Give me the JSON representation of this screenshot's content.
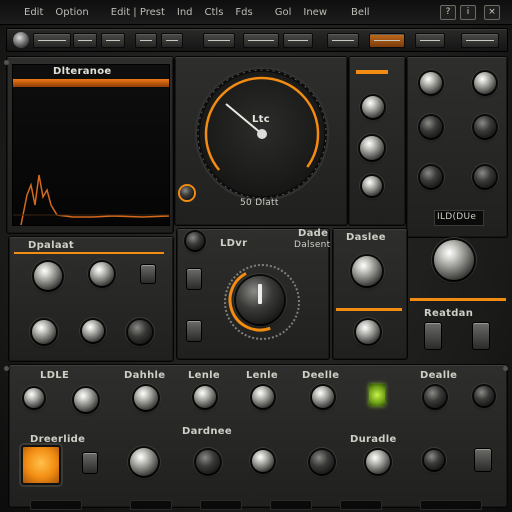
{
  "menu": {
    "items": [
      "Edit",
      "Option",
      "Edit | Prest",
      "Ind",
      "Ctls",
      "Fds",
      "Gol",
      "Inew",
      "Bell"
    ]
  },
  "window": {
    "help": "?",
    "info": "i",
    "close": "×"
  },
  "screen": {
    "title": "Dlteranoe"
  },
  "gauge": {
    "center_label": "Ltc",
    "bottom_label": "50 Dlatt"
  },
  "labels": {
    "right_display": "ILD(DUe",
    "left_mid_header": "Dpalaat",
    "center_mid_header": "LDvr",
    "center_mid_header2": "Dade",
    "center_mid_sub": "Dalsent",
    "right_mid_header": "Daslee",
    "right_bottom_header": "Reatdan",
    "bottom_left_header": "LDLE",
    "bottom_col2_header": "Dahhle",
    "bottom_col3_header": "Lenle",
    "bottom_col4_header": "Lenle",
    "bottom_col5_header": "Deelle",
    "bottom_col6_header": "Dealle",
    "bottom_left_section": "Dreerlide",
    "bottom_col3_section": "Dardnee",
    "bottom_col5_section": "Duradle"
  },
  "colors": {
    "accent": "#f28c12",
    "led": "#8bc32a",
    "panel": "#2a2a28"
  },
  "icons": [
    "power-icon",
    "menu-lines-icon"
  ]
}
